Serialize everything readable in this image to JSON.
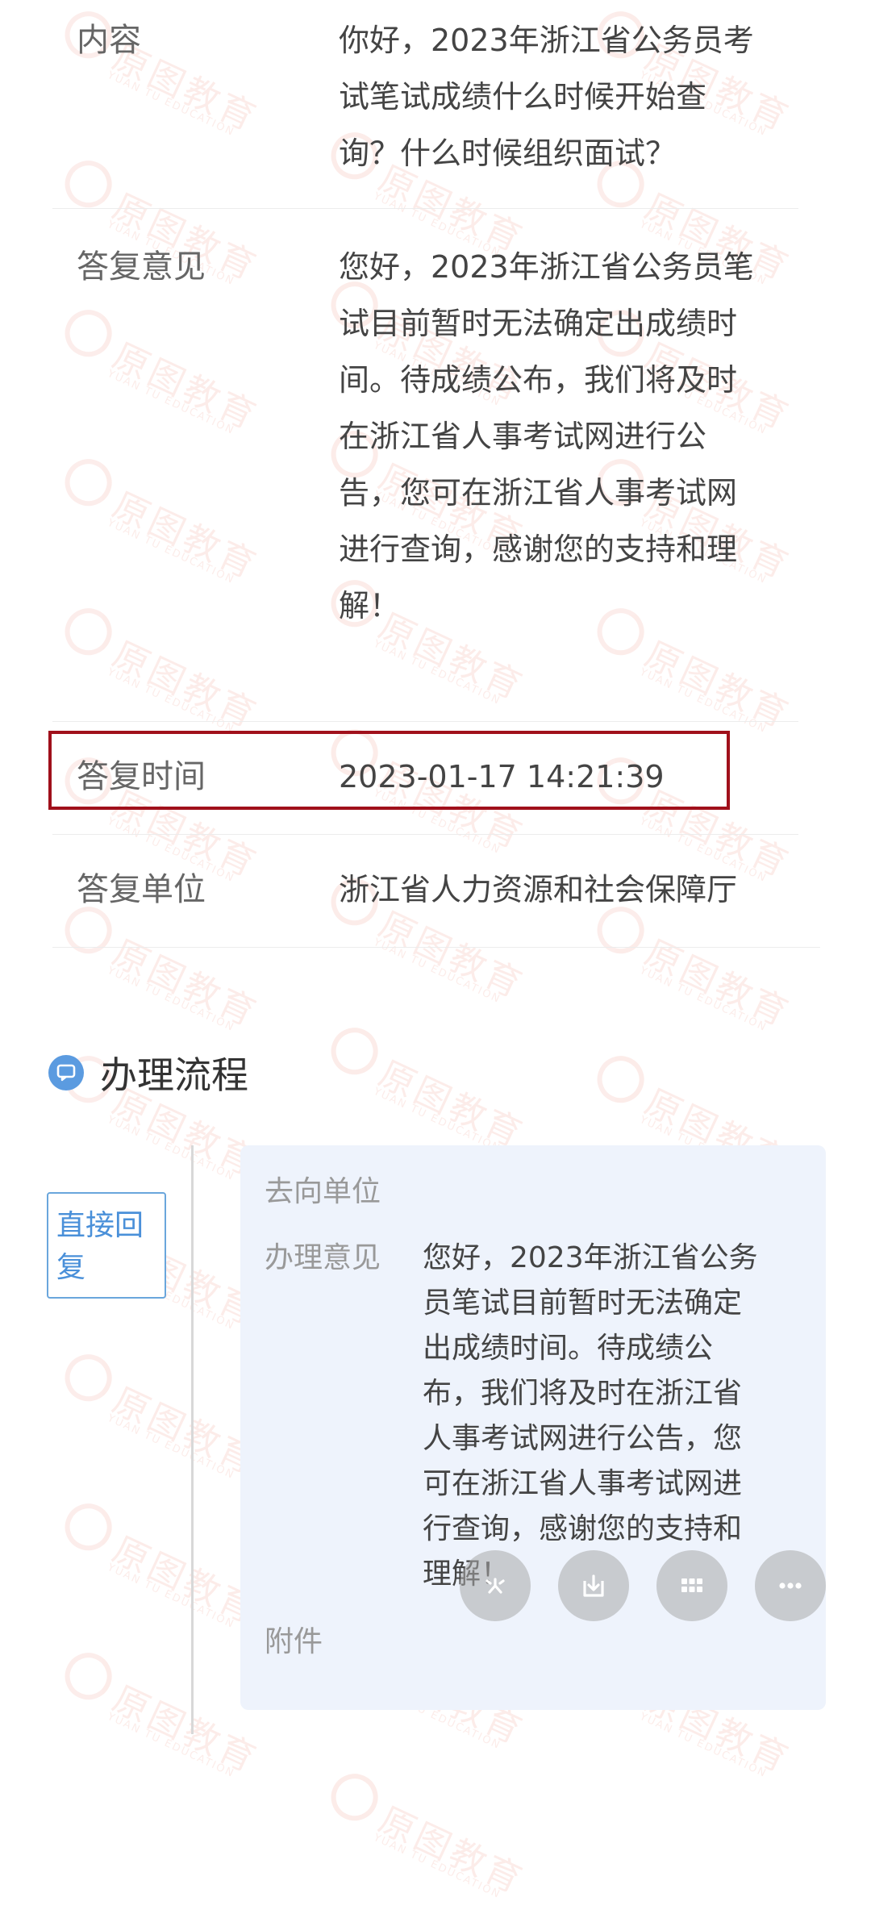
{
  "watermark": {
    "brand_text": "原图教育",
    "sub_text": "YUAN TU EDUCATION"
  },
  "info": {
    "content_label": "内容",
    "content_value": "你好，2023年浙江省公务员考\n试笔试成绩什么时候开始查\n询？什么时候组织面试？",
    "reply_opinion_label": "答复意见",
    "reply_opinion_value": "您好，2023年浙江省公务员笔\n试目前暂时无法确定出成绩时\n间。待成绩公布，我们将及时\n在浙江省人事考试网进行公\n告，您可在浙江省人事考试网\n进行查询，感谢您的支持和理\n解！",
    "reply_time_label": "答复时间",
    "reply_time_value": "2023-01-17 14:21:39",
    "reply_unit_label": "答复单位",
    "reply_unit_value": "浙江省人力资源和社会保障厅"
  },
  "process": {
    "title": "办理流程",
    "icon": "chat-bubble-icon",
    "step_tag": "直接回\n复",
    "card": {
      "destination_label": "去向单位",
      "opinion_label": "办理意见",
      "opinion_value": "您好，2023年浙江省公务\n员笔试目前暂时无法确定\n出成绩时间。待成绩公\n布，我们将及时在浙江省\n人事考试网进行公告，您\n可在浙江省人事考试网进\n行查询，感谢您的支持和\n理解！",
      "attachment_label": "附件"
    }
  },
  "floating_buttons": [
    {
      "icon": "sparkle-icon"
    },
    {
      "icon": "download-icon"
    },
    {
      "icon": "grid-icon"
    },
    {
      "icon": "more-icon"
    }
  ],
  "colors": {
    "highlight_border": "#a0101b",
    "accent_blue": "#5b9be0",
    "card_bg": "#eef3fc",
    "watermark": "#e03a1e"
  }
}
